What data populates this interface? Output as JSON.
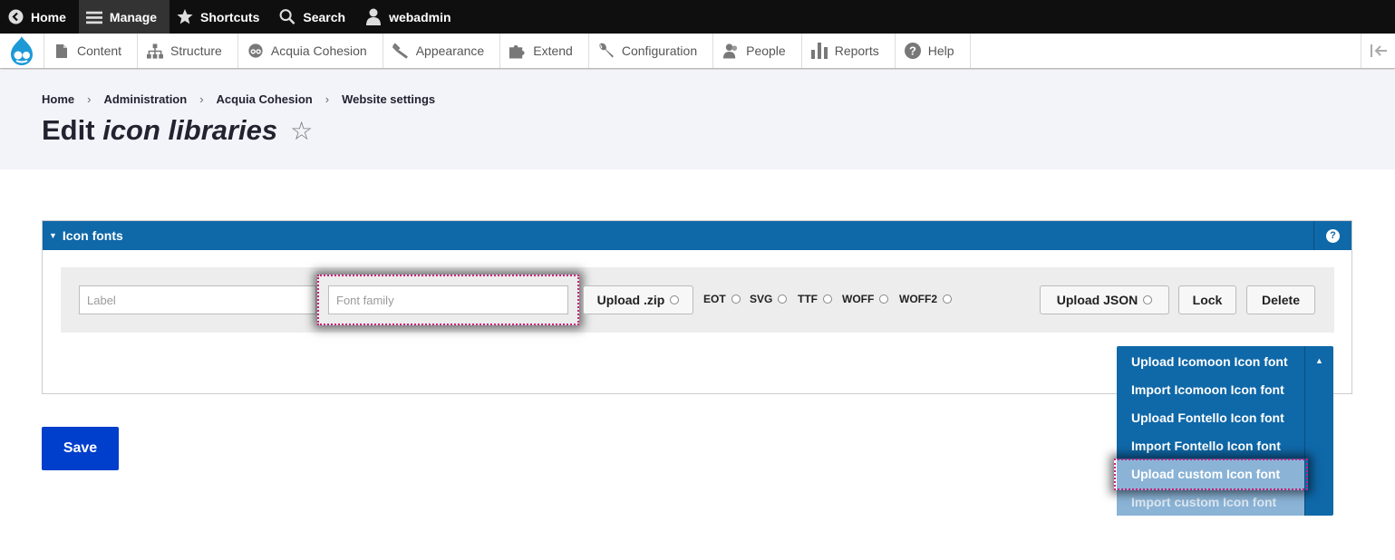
{
  "toolbar": {
    "home": "Home",
    "manage": "Manage",
    "shortcuts": "Shortcuts",
    "search": "Search",
    "user": "webadmin"
  },
  "tray": {
    "items": [
      {
        "label": "Content",
        "icon": "file-icon"
      },
      {
        "label": "Structure",
        "icon": "sitemap-icon"
      },
      {
        "label": "Acquia Cohesion",
        "icon": "cohesion-icon"
      },
      {
        "label": "Appearance",
        "icon": "paintbrush-icon"
      },
      {
        "label": "Extend",
        "icon": "puzzle-icon"
      },
      {
        "label": "Configuration",
        "icon": "wrench-icon"
      },
      {
        "label": "People",
        "icon": "people-icon"
      },
      {
        "label": "Reports",
        "icon": "bar-chart-icon"
      },
      {
        "label": "Help",
        "icon": "help-icon"
      }
    ]
  },
  "breadcrumb": [
    "Home",
    "Administration",
    "Acquia Cohesion",
    "Website settings"
  ],
  "title": {
    "prefix": "Edit",
    "emph": "icon libraries",
    "star": "☆"
  },
  "panel": {
    "heading": "Icon fonts",
    "help": "?",
    "label_placeholder": "Label",
    "family_placeholder": "Font family",
    "upload_zip": "Upload .zip",
    "formats": [
      "EOT",
      "SVG",
      "TTF",
      "WOFF",
      "WOFF2"
    ],
    "upload_json": "Upload JSON",
    "lock": "Lock",
    "delete": "Delete"
  },
  "dropdown": {
    "items": [
      "Upload Icomoon Icon font",
      "Import Icomoon Icon font",
      "Upload Fontello Icon font",
      "Import Fontello Icon font",
      "Upload custom Icon font",
      "Import custom Icon font"
    ],
    "highlighted": "Upload custom Icon font"
  },
  "save": "Save",
  "colors": {
    "toolbar": "#0f0f0f",
    "panel_header": "#0f68a8",
    "save_button": "#003ecc",
    "highlight": "#cc1f7a"
  }
}
